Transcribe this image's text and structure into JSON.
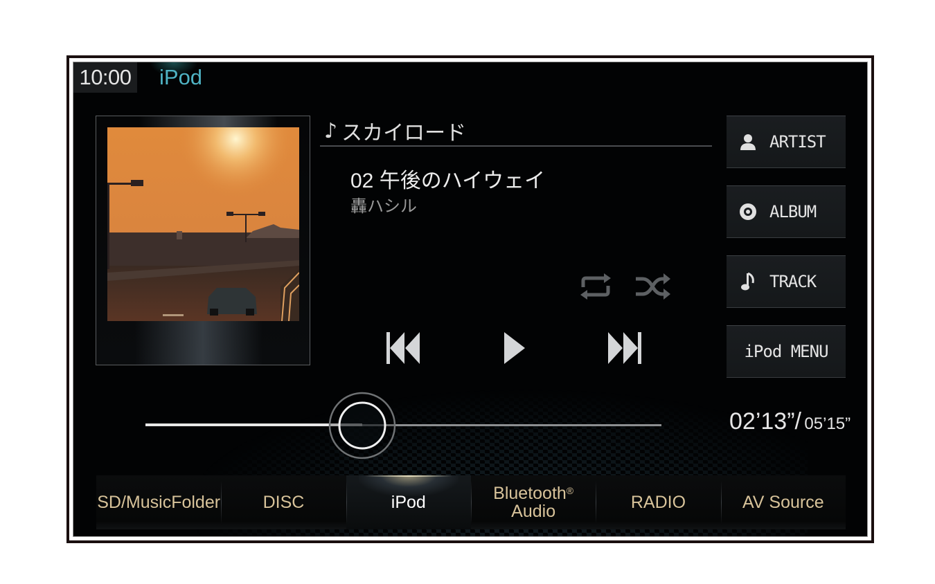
{
  "status_bar": {
    "clock": "10:00",
    "source": "iPod"
  },
  "now_playing": {
    "album_icon": "music-note-icon",
    "album": "スカイロード",
    "track_number": "02",
    "track_title": "午後のハイウェイ",
    "artist": "轟ハシル",
    "album_art": "Sunset highway with street lamps and a car"
  },
  "modes": {
    "repeat_icon": "repeat-icon",
    "shuffle_icon": "shuffle-icon"
  },
  "controls": {
    "previous_icon": "skip-previous-icon",
    "play_icon": "play-icon",
    "next_icon": "skip-next-icon"
  },
  "progress": {
    "elapsed": "02’13”",
    "separator": "/",
    "total": "05’15”",
    "fraction": 0.42
  },
  "side_menu": [
    {
      "label": "ARTIST",
      "icon": "person-icon"
    },
    {
      "label": "ALBUM",
      "icon": "disc-icon"
    },
    {
      "label": "TRACK",
      "icon": "music-note-icon"
    },
    {
      "label": "iPod MENU",
      "icon": ""
    }
  ],
  "source_tabs": [
    {
      "label": "SD/MusicFolder",
      "active": false
    },
    {
      "label": "DISC",
      "active": false
    },
    {
      "label": "iPod",
      "active": true
    },
    {
      "label_line1": "Bluetooth",
      "trademark": "®",
      "label_line2": "Audio",
      "active": false
    },
    {
      "label": "RADIO",
      "active": false
    },
    {
      "label": "AV Source",
      "active": false
    }
  ],
  "colors": {
    "source_title": "#4fb3c4",
    "tab_text": "#d8c39a",
    "tab_active_text": "#ffffff"
  }
}
